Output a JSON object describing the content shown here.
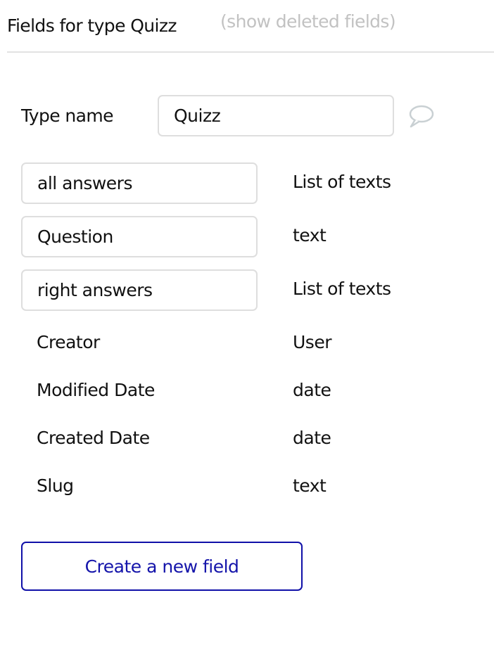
{
  "header": {
    "title": "Fields for type Quizz",
    "show_deleted_link": "(show deleted fields)"
  },
  "type_name": {
    "label": "Type name",
    "value": "Quizz",
    "comment_icon": "speech-bubble-icon"
  },
  "fields": [
    {
      "name": "all answers",
      "type": "List of texts",
      "editable": true
    },
    {
      "name": "Question",
      "type": "text",
      "editable": true
    },
    {
      "name": "right answers",
      "type": "List of texts",
      "editable": true
    },
    {
      "name": "Creator",
      "type": "User",
      "editable": false
    },
    {
      "name": "Modified Date",
      "type": "date",
      "editable": false
    },
    {
      "name": "Created Date",
      "type": "date",
      "editable": false
    },
    {
      "name": "Slug",
      "type": "text",
      "editable": false
    }
  ],
  "actions": {
    "create_field_label": "Create a new field"
  },
  "colors": {
    "primary_blue": "#1414aa",
    "muted_link": "#c2c2c2",
    "input_border": "#dedede",
    "divider": "#e2e2e2"
  }
}
